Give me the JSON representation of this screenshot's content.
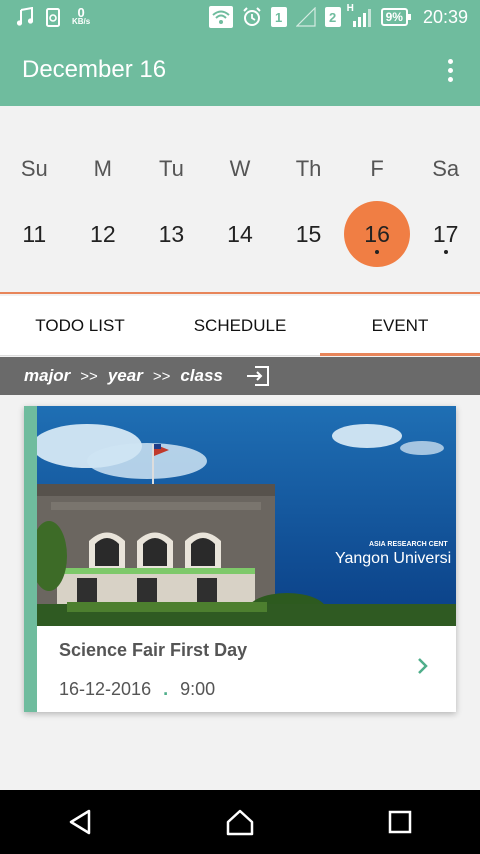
{
  "status_bar": {
    "net_speed_value": "0",
    "net_speed_unit": "KB/s",
    "sim1": "1",
    "sim2": "2",
    "signal_type": "H",
    "battery": "9%",
    "time": "20:39"
  },
  "app_bar": {
    "title": "December 16",
    "menu_icon": "more-vert-icon"
  },
  "week": {
    "days": [
      {
        "dow": "Su",
        "date": "11",
        "selected": false,
        "has_event": false
      },
      {
        "dow": "M",
        "date": "12",
        "selected": false,
        "has_event": false
      },
      {
        "dow": "Tu",
        "date": "13",
        "selected": false,
        "has_event": false
      },
      {
        "dow": "W",
        "date": "14",
        "selected": false,
        "has_event": false
      },
      {
        "dow": "Th",
        "date": "15",
        "selected": false,
        "has_event": false
      },
      {
        "dow": "F",
        "date": "16",
        "selected": true,
        "has_event": true
      },
      {
        "dow": "Sa",
        "date": "17",
        "selected": false,
        "has_event": true
      }
    ]
  },
  "tabs": [
    {
      "label": "TODO LIST",
      "active": false
    },
    {
      "label": "SCHEDULE",
      "active": false
    },
    {
      "label": "EVENT",
      "active": true
    }
  ],
  "filter": {
    "major": "major",
    "year": "year",
    "class": "class",
    "sep": ">>"
  },
  "event_card": {
    "image_caption_small": "ASIA RESEARCH CENT",
    "image_caption": "Yangon Universi",
    "title": "Science Fair First Day",
    "date": "16-12-2016",
    "separator": ".",
    "time": "9:00"
  },
  "colors": {
    "primary": "#6fbc9e",
    "accent": "#f07e44",
    "tab_indicator": "#e8855a"
  }
}
